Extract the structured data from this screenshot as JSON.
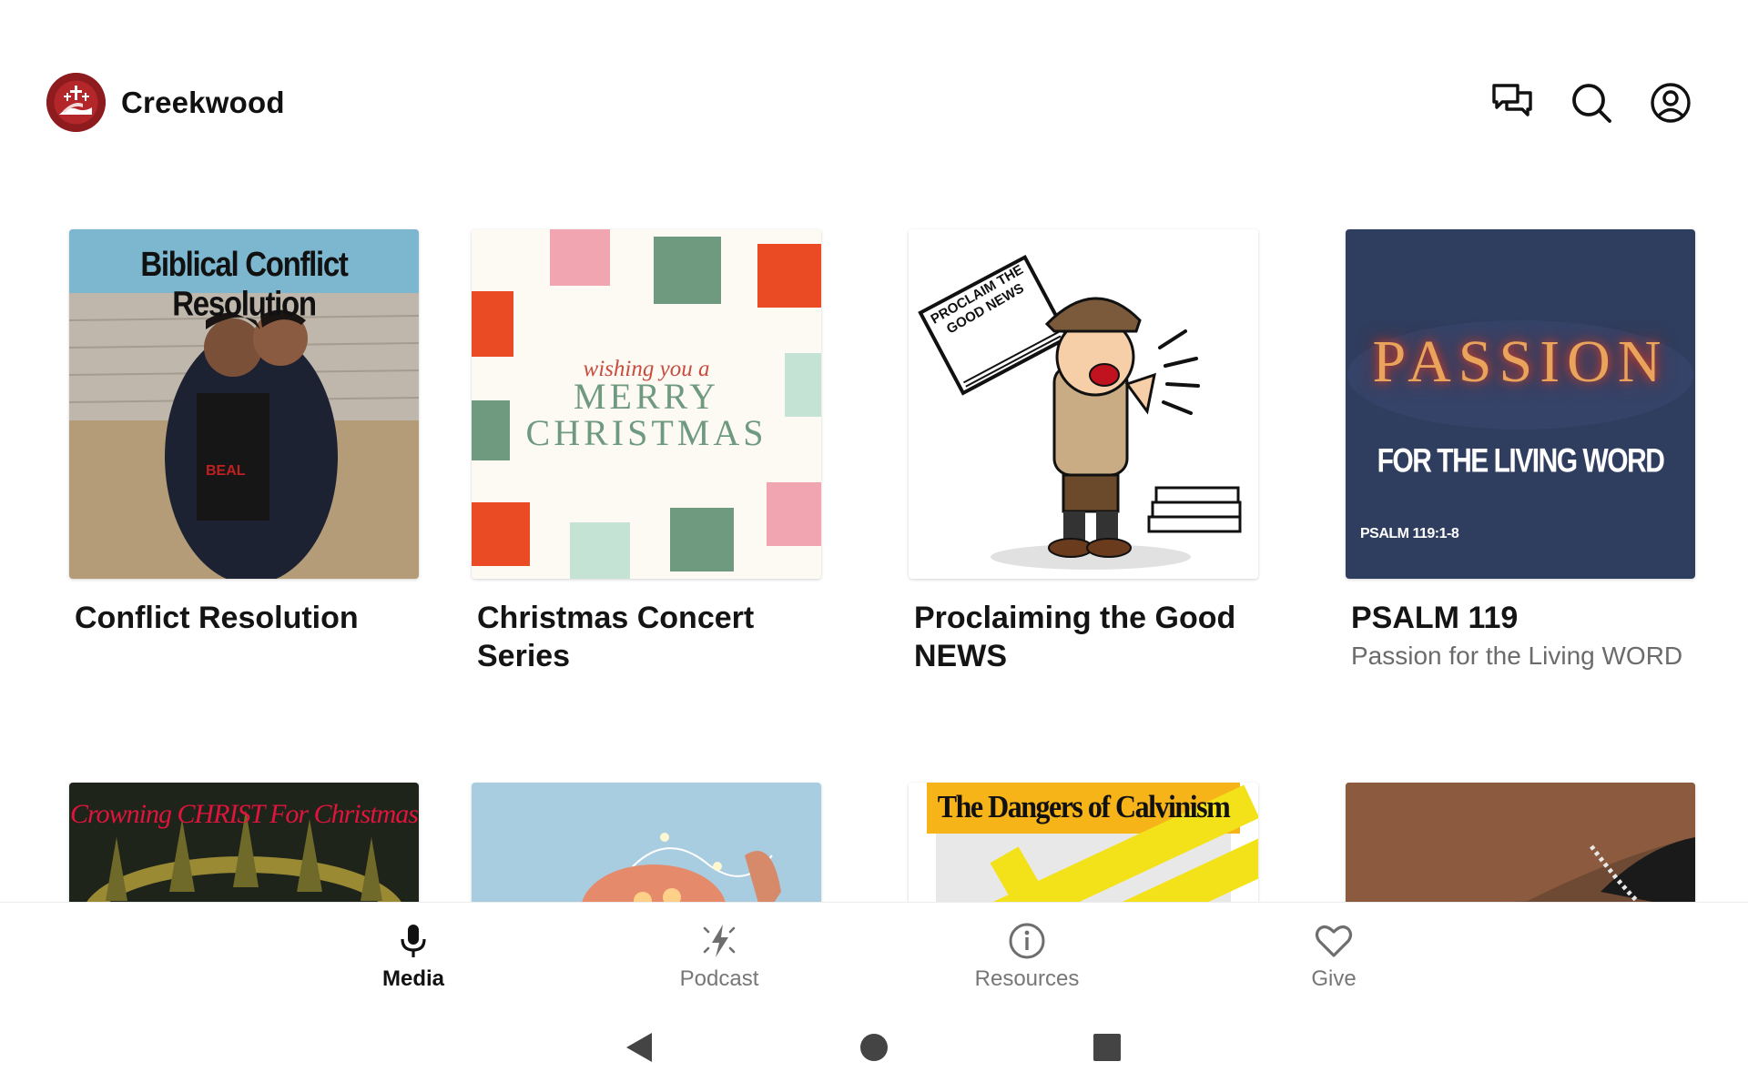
{
  "app": {
    "name": "Creekwood"
  },
  "header": {
    "icons": [
      "chat-icon",
      "search-icon",
      "account-icon"
    ]
  },
  "cards": [
    {
      "title": "Conflict Resolution",
      "subtitle": "",
      "artwork_text": "Biblical Conflict Resolution"
    },
    {
      "title": "Christmas Concert Series",
      "subtitle": "",
      "artwork_text": {
        "script": "wishing you a",
        "line1": "MERRY",
        "line2": "CHRISTMAS"
      }
    },
    {
      "title": "Proclaiming the Good NEWS",
      "subtitle": "",
      "artwork_text": {
        "line1": "PROCLAIM THE",
        "line2": "GOOD NEWS"
      }
    },
    {
      "title": "PSALM 119",
      "subtitle": "Passion for the Living WORD",
      "artwork_text": {
        "line1": "PASSION",
        "line2": "FOR THE LIVING WORD",
        "ref": "PSALM 119:1-8"
      }
    },
    {
      "title": "",
      "subtitle": "",
      "artwork_text": "Crowning CHRIST For Christmas"
    },
    {
      "title": "",
      "subtitle": "",
      "artwork_text": ""
    },
    {
      "title": "",
      "subtitle": "",
      "artwork_text": "The Dangers of Calvinism"
    },
    {
      "title": "",
      "subtitle": "",
      "artwork_text": ""
    }
  ],
  "bottom_nav": {
    "items": [
      {
        "label": "Media",
        "icon": "microphone-icon",
        "active": true
      },
      {
        "label": "Podcast",
        "icon": "podcast-icon",
        "active": false
      },
      {
        "label": "Resources",
        "icon": "info-icon",
        "active": false
      },
      {
        "label": "Give",
        "icon": "heart-icon",
        "active": false
      }
    ]
  },
  "system_bar": {
    "buttons": [
      "back-icon",
      "home-icon",
      "recents-icon"
    ]
  },
  "colors": {
    "brand": "#8e1b1e",
    "text": "#141414",
    "muted": "#6b6b6b",
    "nav_inactive": "#777777"
  }
}
